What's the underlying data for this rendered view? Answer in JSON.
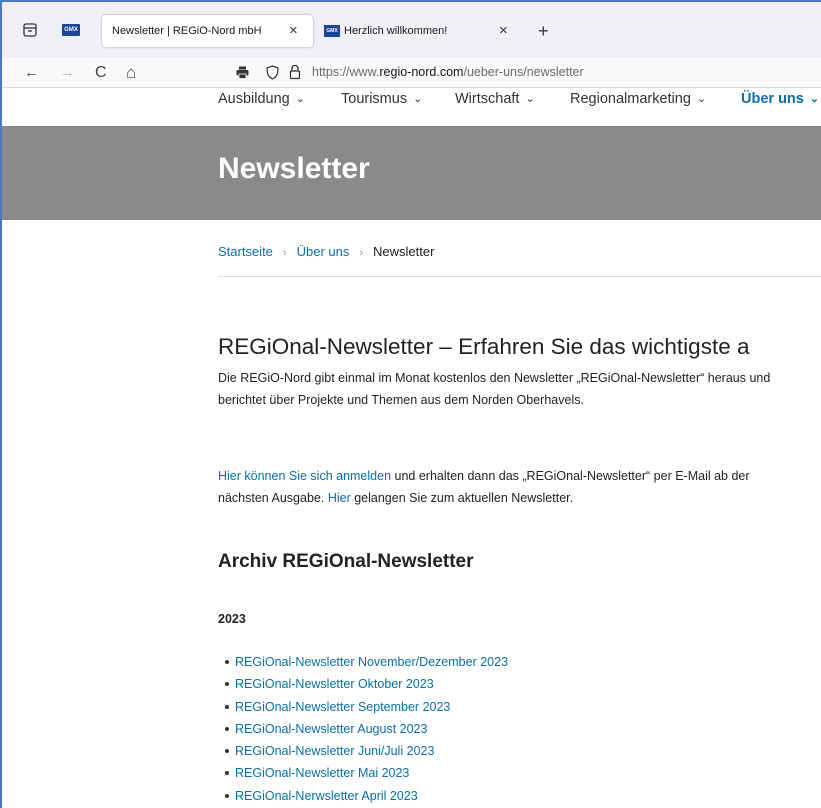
{
  "browser": {
    "tabs": [
      {
        "title": "Newsletter | REGiO-Nord mbH",
        "active": true
      },
      {
        "title": "Herzlich willkommen!",
        "favicon": "GMX",
        "active": false
      }
    ],
    "pinned_favicon": "GMX",
    "close_glyph": "×",
    "new_tab_glyph": "+",
    "nav": {
      "back": "←",
      "forward": "→",
      "reload": "C",
      "home": "⌂"
    },
    "url": {
      "scheme_prefix": "https://www.",
      "host": "regio-nord.com",
      "path": "/ueber-uns/newsletter"
    }
  },
  "site": {
    "menu": [
      {
        "label": "Ausbildung",
        "chevron": "⌄"
      },
      {
        "label": "Tourismus",
        "chevron": "⌄"
      },
      {
        "label": "Wirtschaft",
        "chevron": "⌄"
      },
      {
        "label": "Regionalmarketing",
        "chevron": "⌄"
      },
      {
        "label": "Über uns",
        "chevron": "⌄",
        "active": true
      }
    ],
    "hero_title": "Newsletter",
    "breadcrumb": {
      "items": [
        "Startseite",
        "Über uns",
        "Newsletter"
      ],
      "separator": "›"
    },
    "heading": "REGiOnal-Newsletter – Erfahren Sie das wichtigste a",
    "intro_line1": "Die REGiO-Nord gibt einmal im Monat kostenlos den Newsletter „REGiOnal-Newsletter“ heraus und",
    "intro_line2": "berichtet über Projekte und Themen aus dem Norden Oberhavels.",
    "signup_link": "Hier können Sie sich anmelden",
    "signup_text": " und erhalten dann das „REGiOnal-Newsletter“ per E-Mail ab der",
    "signup_line2_pre": "nächsten Ausgabe. ",
    "signup_line2_link": "Hier",
    "signup_line2_post": " gelangen Sie zum aktuellen Newsletter.",
    "archive_heading": "Archiv REGiOnal-Newsletter",
    "archive_year": "2023",
    "archive_items": [
      "REGiOnal-Newsletter November/Dezember 2023",
      "REGiOnal-Newsletter Oktober 2023",
      "REGiOnal-Newsletter September 2023",
      "REGiOnal-Newsletter August 2023",
      "REGiOnal-Newsletter Juni/Juli 2023",
      "REGiOnal-Newsletter Mai 2023",
      "REGiOnal-Nerwsletter April 2023"
    ]
  },
  "colors": {
    "link": "#0a6ea8",
    "hero_bg": "#8a8a8a",
    "gmx_blue": "#1c449b"
  }
}
